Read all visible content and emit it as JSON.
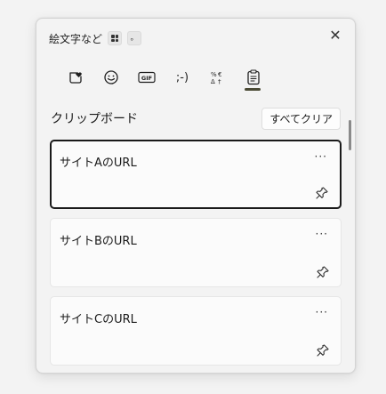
{
  "title": "絵文字など",
  "close_label": "✕",
  "tabs": [
    {
      "name": "tab-emoji-heart",
      "label": "",
      "active": false
    },
    {
      "name": "tab-emoji",
      "label": "☺",
      "active": false
    },
    {
      "name": "tab-gif",
      "label": "",
      "active": false
    },
    {
      "name": "tab-kaomoji",
      "label": ";-)",
      "active": false
    },
    {
      "name": "tab-symbols",
      "label": "",
      "active": false
    },
    {
      "name": "tab-clipboard",
      "label": "",
      "active": true
    }
  ],
  "section": {
    "title": "クリップボード",
    "clear_label": "すべてクリア"
  },
  "items": [
    {
      "text": "サイトAのURL",
      "more": "···"
    },
    {
      "text": "サイトBのURL",
      "more": "···"
    },
    {
      "text": "サイトCのURL",
      "more": "···"
    }
  ],
  "colors": {
    "accent_underline": "#4b4b36",
    "selected_border": "#1a1a1a"
  }
}
